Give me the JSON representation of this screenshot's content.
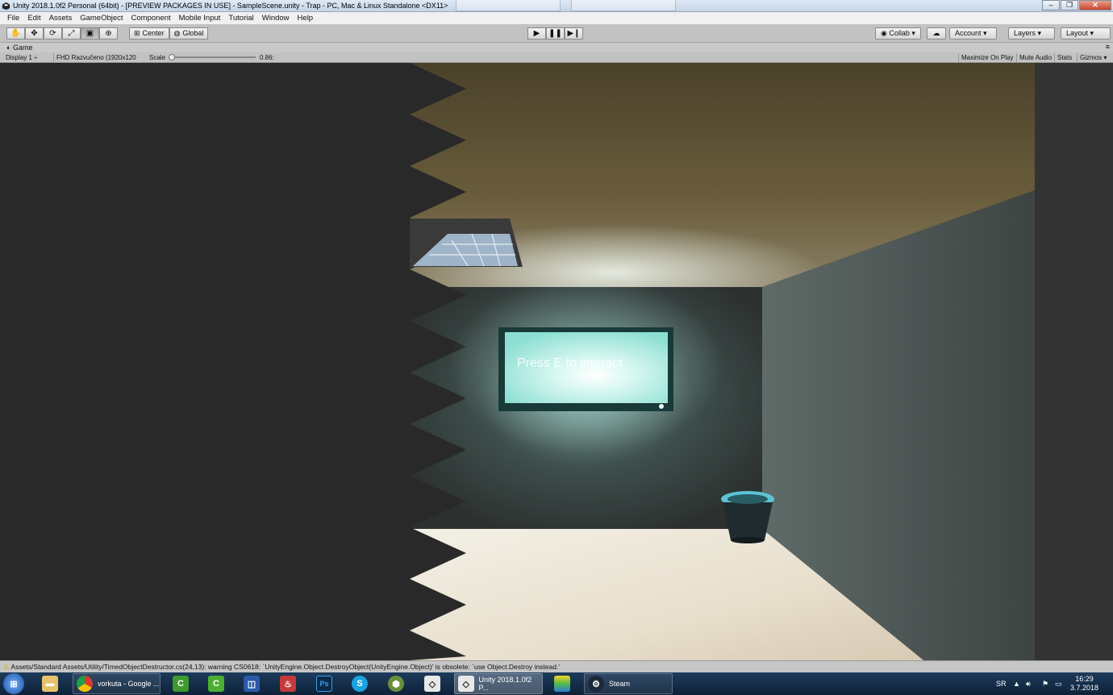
{
  "window": {
    "title": "Unity 2018.1.0f2 Personal (64bit) - [PREVIEW PACKAGES IN USE] - SampleScene.unity - Trap - PC, Mac & Linux Standalone <DX11>"
  },
  "menu": [
    "File",
    "Edit",
    "Assets",
    "GameObject",
    "Component",
    "Mobile Input",
    "Tutorial",
    "Window",
    "Help"
  ],
  "toolbar": {
    "pivot_label": "Center",
    "space_label": "Global",
    "collab_label": "Collab",
    "account_label": "Account",
    "layers_label": "Layers",
    "layout_label": "Layout"
  },
  "game_view": {
    "tab_label": "Game",
    "display": "Display 1",
    "resolution": "FHD Razvučeno (1920x120",
    "scale_label": "Scale",
    "scale_value": "0.86:",
    "scale_fraction": 0.05,
    "buttons": [
      "Maximize On Play",
      "Mute Audio",
      "Stats",
      "Gizmos"
    ],
    "prompt_text": "Press E to interact"
  },
  "status": {
    "message": "Assets/Standard Assets/Utility/TimedObjectDestructor.cs(24,13): warning CS0618: `UnityEngine.Object.DestroyObject(UnityEngine.Object)' is obsolete: `use Object.Destroy instead.'"
  },
  "taskbar": {
    "chrome_label": "vorkuta - Google ...",
    "unity_label": "Unity 2018.1.0f2 P...",
    "steam_label": "Steam",
    "lang": "SR",
    "time": "16:29",
    "date": "3.7.2018"
  },
  "colors": {
    "toolbar_bg": "#c2c2c2",
    "viewport_bg": "#292929",
    "screen_glow": "#bff4ec",
    "taskbar": "#0d2238"
  }
}
